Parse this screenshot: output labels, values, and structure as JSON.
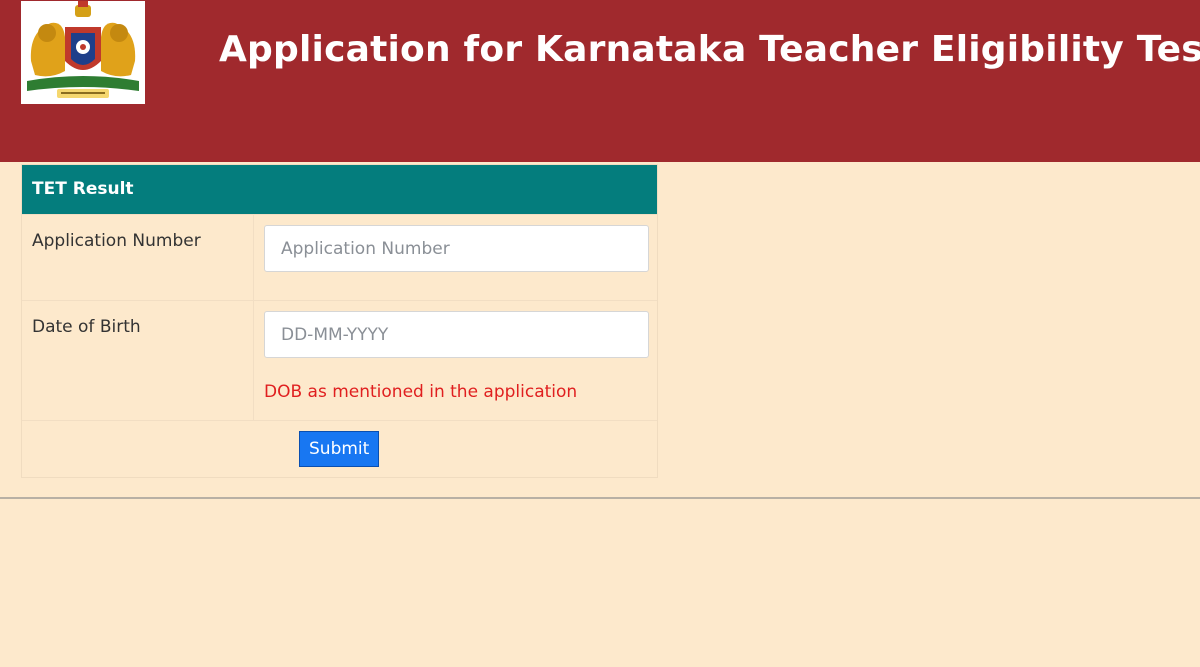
{
  "header": {
    "title": "Application for Karnataka Teacher Eligibility Test (KARTET)",
    "background_color": "#a0292d",
    "emblem_icon": "karnataka-emblem-icon"
  },
  "panel": {
    "heading": "TET Result",
    "heading_color": "#047d7d",
    "fields": [
      {
        "label": "Application Number",
        "value": "",
        "placeholder": "Application Number"
      },
      {
        "label": "Date of Birth",
        "value": "",
        "placeholder": "DD-MM-YYYY",
        "hint": "DOB as mentioned in the application"
      }
    ],
    "submit_label": "Submit",
    "submit_color": "#1877f2"
  },
  "page_background": "#fde9cc"
}
